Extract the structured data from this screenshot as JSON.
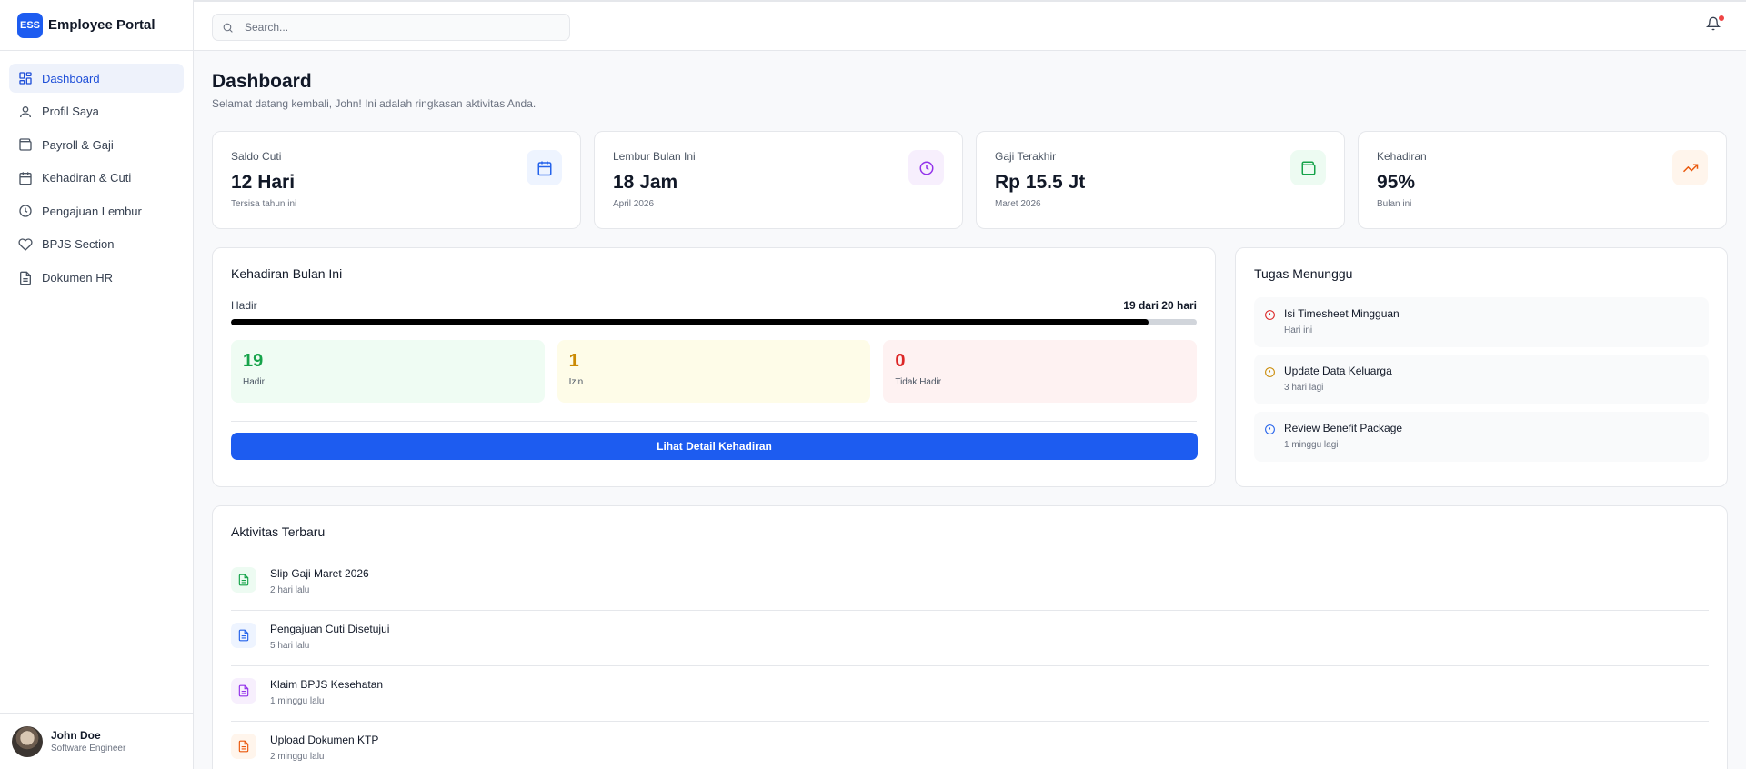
{
  "brand": {
    "logo": "ESS",
    "name": "Employee Portal"
  },
  "sidebar": {
    "items": [
      {
        "label": "Dashboard",
        "icon": "dashboard-icon",
        "active": true
      },
      {
        "label": "Profil Saya",
        "icon": "user-icon"
      },
      {
        "label": "Payroll & Gaji",
        "icon": "wallet-icon"
      },
      {
        "label": "Kehadiran & Cuti",
        "icon": "calendar-icon"
      },
      {
        "label": "Pengajuan Lembur",
        "icon": "clock-icon"
      },
      {
        "label": "BPJS Section",
        "icon": "heart-icon"
      },
      {
        "label": "Dokumen HR",
        "icon": "document-icon"
      }
    ]
  },
  "user": {
    "name": "John Doe",
    "role": "Software Engineer"
  },
  "search": {
    "placeholder": "Search..."
  },
  "page": {
    "title": "Dashboard",
    "subtitle": "Selamat datang kembali, John! Ini adalah ringkasan aktivitas Anda."
  },
  "stats": [
    {
      "label": "Saldo Cuti",
      "value": "12 Hari",
      "note": "Tersisa tahun ini",
      "icon": "calendar-icon",
      "color": "#2563eb",
      "bg": "#eef4ff"
    },
    {
      "label": "Lembur Bulan Ini",
      "value": "18 Jam",
      "note": "April 2026",
      "icon": "clock-icon",
      "color": "#9333ea",
      "bg": "#f7effd"
    },
    {
      "label": "Gaji Terakhir",
      "value": "Rp 15.5 Jt",
      "note": "Maret 2026",
      "icon": "wallet-icon",
      "color": "#16a34a",
      "bg": "#edfbf2"
    },
    {
      "label": "Kehadiran",
      "value": "95%",
      "note": "Bulan ini",
      "icon": "trending-up-icon",
      "color": "#ea580c",
      "bg": "#fff5ec"
    }
  ],
  "attendance": {
    "title": "Kehadiran Bulan Ini",
    "progress_label": "Hadir",
    "progress_value": "19 dari 20 hari",
    "progress_fraction": 0.95,
    "boxes": [
      {
        "value": "19",
        "label": "Hadir",
        "color": "#16a34a",
        "bg": "#effcf3"
      },
      {
        "value": "1",
        "label": "Izin",
        "color": "#ca8a04",
        "bg": "#fefce8"
      },
      {
        "value": "0",
        "label": "Tidak Hadir",
        "color": "#dc2626",
        "bg": "#fef2f2"
      }
    ],
    "button": "Lihat Detail Kehadiran"
  },
  "tasks": {
    "title": "Tugas Menunggu",
    "items": [
      {
        "title": "Isi Timesheet Mingguan",
        "due": "Hari ini",
        "color": "#dc2626"
      },
      {
        "title": "Update Data Keluarga",
        "due": "3 hari lagi",
        "color": "#ca8a04"
      },
      {
        "title": "Review Benefit Package",
        "due": "1 minggu lagi",
        "color": "#2563eb"
      }
    ]
  },
  "activities": {
    "title": "Aktivitas Terbaru",
    "items": [
      {
        "title": "Slip Gaji Maret 2026",
        "time": "2 hari lalu",
        "color": "#16a34a",
        "bg": "#edfbf2"
      },
      {
        "title": "Pengajuan Cuti Disetujui",
        "time": "5 hari lalu",
        "color": "#2563eb",
        "bg": "#eef4ff"
      },
      {
        "title": "Klaim BPJS Kesehatan",
        "time": "1 minggu lalu",
        "color": "#9333ea",
        "bg": "#f7effd"
      },
      {
        "title": "Upload Dokumen KTP",
        "time": "2 minggu lalu",
        "color": "#ea580c",
        "bg": "#fff5ec"
      }
    ]
  }
}
